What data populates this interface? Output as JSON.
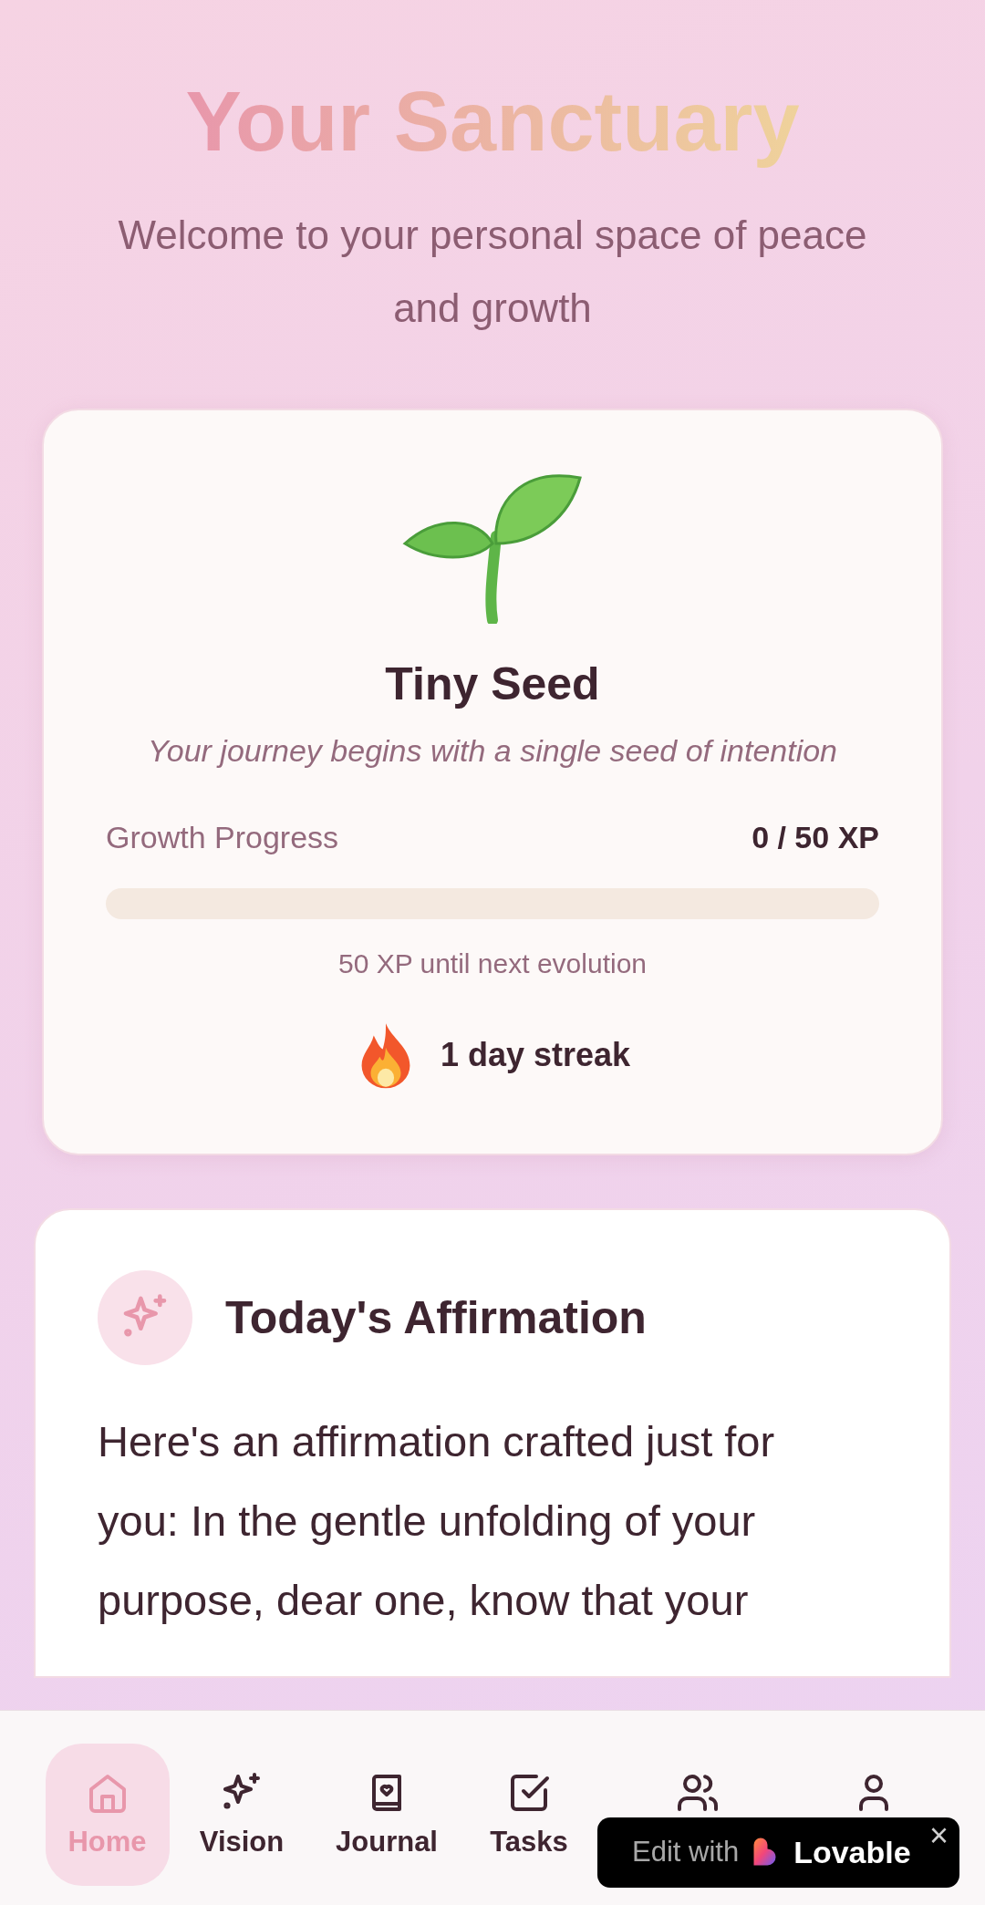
{
  "header": {
    "title": "Your Sanctuary",
    "subtitle": "Welcome to your personal space of peace and growth"
  },
  "growth_card": {
    "stage": "Tiny Seed",
    "tagline": "Your journey begins with a single seed of intention",
    "progress_label": "Growth Progress",
    "progress_value": "0 / 50 XP",
    "level": 0,
    "next_evolution": "50 XP until next evolution",
    "streak": "1 day streak"
  },
  "affirmation_card": {
    "title": "Today's Affirmation",
    "text": "Here's an affirmation crafted just for you: In the gentle unfolding of your purpose, dear one, know that your"
  },
  "bottom_nav": [
    {
      "label": "Home",
      "selected": true
    },
    {
      "label": "Vision",
      "selected": false
    },
    {
      "label": "Journal",
      "selected": false
    },
    {
      "label": "Tasks",
      "selected": false
    },
    {
      "selected": false
    },
    {
      "selected": false
    }
  ],
  "edit_badge": {
    "prefix": "Edit with",
    "brand": "Lovable",
    "close": "×"
  }
}
